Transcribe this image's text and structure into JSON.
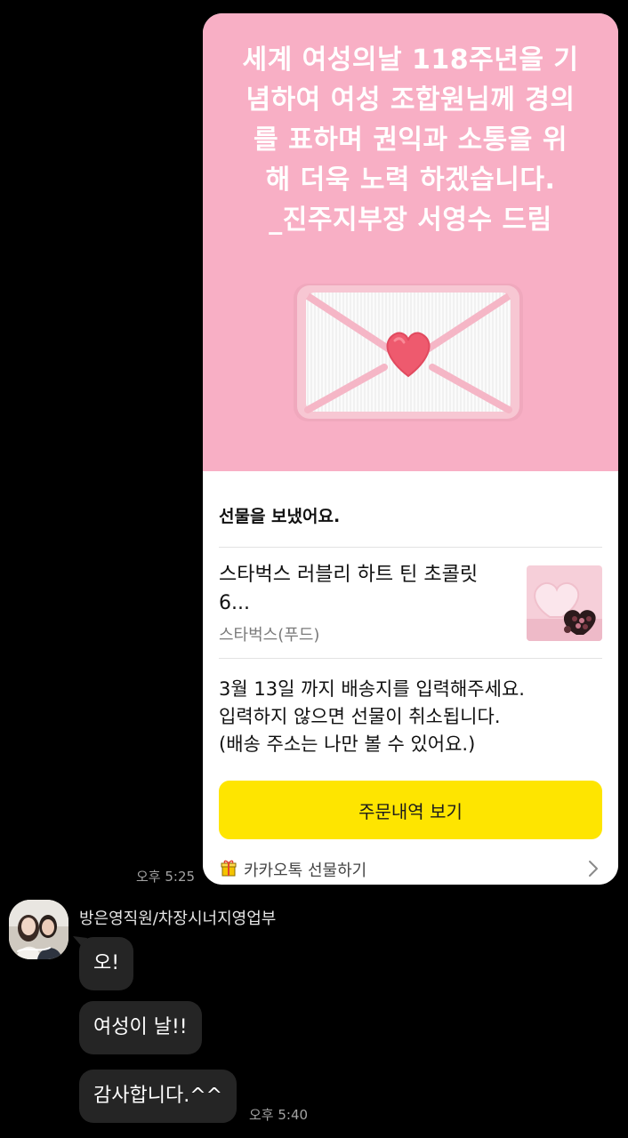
{
  "gift_message": {
    "banner_text": "세계 여성의날 118주년을 기\n념하여 여성 조합원님께 경의\n를 표하며 권익과 소통을 위\n해 더욱 노력 하겠습니다.\n_진주지부장 서영수 드림",
    "heading": "선물을 보냈어요.",
    "product_name": "스타벅스 러블리 하트 틴 초콜릿\n6...",
    "product_brand": "스타벅스(푸드)",
    "notice_text": "3월 13일 까지 배송지를 입력해주세요.\n입력하지 않으면 선물이 취소됩니다.\n(배송 주소는 나만 볼 수 있어요.)",
    "order_button_label": "주문내역 보기",
    "footer_label": "카카오톡 선물하기",
    "footer_icon": "gift-box-icon",
    "time": "오후 5:25"
  },
  "reply": {
    "sender_name": "방은영직원/차장시너지영업부",
    "messages": [
      "오!",
      "여성이 날!!",
      "감사합니다.^^"
    ],
    "time": "오후 5:40"
  },
  "colors": {
    "background": "#000000",
    "banner_pink": "#f8afc5",
    "button_yellow": "#fee500",
    "bubble": "#252525",
    "timestamp": "#a3a3a3"
  }
}
